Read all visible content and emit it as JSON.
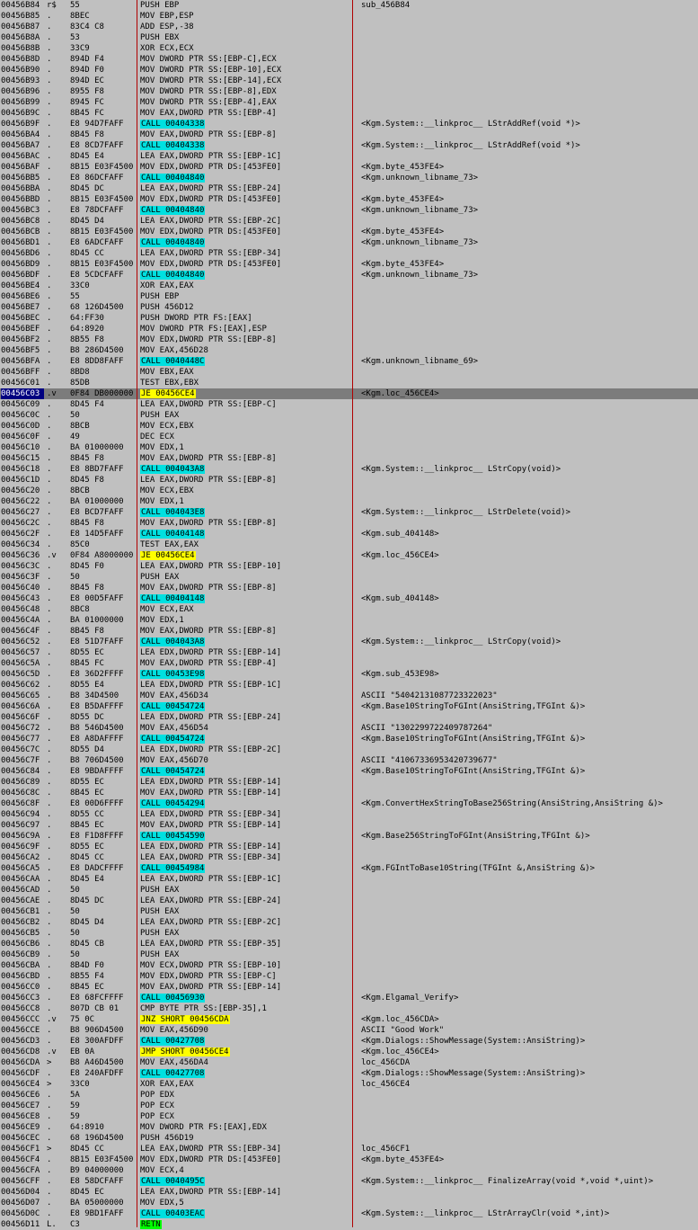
{
  "colors": {
    "background": "#c0c0c0",
    "call_highlight": "#00e0e0",
    "jump_highlight": "#ffff00",
    "ret_highlight": "#00ff00",
    "selected_row": "#7c7c7c",
    "address_selected": "#000080",
    "column_divider": "#b00000"
  },
  "rows": [
    {
      "addr": "00456B84",
      "mark": "r$",
      "hex": "55",
      "ins": "PUSH EBP",
      "cmt": "sub_456B84"
    },
    {
      "addr": "00456B85",
      "mark": ".",
      "hex": "8BEC",
      "ins": "MOV EBP,ESP",
      "cmt": ""
    },
    {
      "addr": "00456B87",
      "mark": ".",
      "hex": "83C4 C8",
      "ins": "ADD ESP,-38",
      "cmt": ""
    },
    {
      "addr": "00456B8A",
      "mark": ".",
      "hex": "53",
      "ins": "PUSH EBX",
      "cmt": ""
    },
    {
      "addr": "00456B8B",
      "mark": ".",
      "hex": "33C9",
      "ins": "XOR ECX,ECX",
      "cmt": ""
    },
    {
      "addr": "00456B8D",
      "mark": ".",
      "hex": "894D F4",
      "ins": "MOV DWORD PTR SS:[EBP-C],ECX",
      "cmt": ""
    },
    {
      "addr": "00456B90",
      "mark": ".",
      "hex": "894D F0",
      "ins": "MOV DWORD PTR SS:[EBP-10],ECX",
      "cmt": ""
    },
    {
      "addr": "00456B93",
      "mark": ".",
      "hex": "894D EC",
      "ins": "MOV DWORD PTR SS:[EBP-14],ECX",
      "cmt": ""
    },
    {
      "addr": "00456B96",
      "mark": ".",
      "hex": "8955 F8",
      "ins": "MOV DWORD PTR SS:[EBP-8],EDX",
      "cmt": ""
    },
    {
      "addr": "00456B99",
      "mark": ".",
      "hex": "8945 FC",
      "ins": "MOV DWORD PTR SS:[EBP-4],EAX",
      "cmt": ""
    },
    {
      "addr": "00456B9C",
      "mark": ".",
      "hex": "8B45 FC",
      "ins": "MOV EAX,DWORD PTR SS:[EBP-4]",
      "cmt": ""
    },
    {
      "addr": "00456B9F",
      "mark": ".",
      "hex": "E8 94D7FAFF",
      "ins": "CALL 00404338",
      "cmt": "<Kgm.System::__linkproc__ LStrAddRef(void *)>"
    },
    {
      "addr": "00456BA4",
      "mark": ".",
      "hex": "8B45 F8",
      "ins": "MOV EAX,DWORD PTR SS:[EBP-8]",
      "cmt": ""
    },
    {
      "addr": "00456BA7",
      "mark": ".",
      "hex": "E8 8CD7FAFF",
      "ins": "CALL 00404338",
      "cmt": "<Kgm.System::__linkproc__ LStrAddRef(void *)>"
    },
    {
      "addr": "00456BAC",
      "mark": ".",
      "hex": "8D45 E4",
      "ins": "LEA EAX,DWORD PTR SS:[EBP-1C]",
      "cmt": ""
    },
    {
      "addr": "00456BAF",
      "mark": ".",
      "hex": "8B15 E03F4500",
      "ins": "MOV EDX,DWORD PTR DS:[453FE0]",
      "cmt": "<Kgm.byte_453FE4>"
    },
    {
      "addr": "00456BB5",
      "mark": ".",
      "hex": "E8 86DCFAFF",
      "ins": "CALL 00404840",
      "cmt": "<Kgm.unknown_libname_73>"
    },
    {
      "addr": "00456BBA",
      "mark": ".",
      "hex": "8D45 DC",
      "ins": "LEA EAX,DWORD PTR SS:[EBP-24]",
      "cmt": ""
    },
    {
      "addr": "00456BBD",
      "mark": ".",
      "hex": "8B15 E03F4500",
      "ins": "MOV EDX,DWORD PTR DS:[453FE0]",
      "cmt": "<Kgm.byte_453FE4>"
    },
    {
      "addr": "00456BC3",
      "mark": ".",
      "hex": "E8 78DCFAFF",
      "ins": "CALL 00404840",
      "cmt": "<Kgm.unknown_libname_73>"
    },
    {
      "addr": "00456BC8",
      "mark": ".",
      "hex": "8D45 D4",
      "ins": "LEA EAX,DWORD PTR SS:[EBP-2C]",
      "cmt": ""
    },
    {
      "addr": "00456BCB",
      "mark": ".",
      "hex": "8B15 E03F4500",
      "ins": "MOV EDX,DWORD PTR DS:[453FE0]",
      "cmt": "<Kgm.byte_453FE4>"
    },
    {
      "addr": "00456BD1",
      "mark": ".",
      "hex": "E8 6ADCFAFF",
      "ins": "CALL 00404840",
      "cmt": "<Kgm.unknown_libname_73>"
    },
    {
      "addr": "00456BD6",
      "mark": ".",
      "hex": "8D45 CC",
      "ins": "LEA EAX,DWORD PTR SS:[EBP-34]",
      "cmt": ""
    },
    {
      "addr": "00456BD9",
      "mark": ".",
      "hex": "8B15 E03F4500",
      "ins": "MOV EDX,DWORD PTR DS:[453FE0]",
      "cmt": "<Kgm.byte_453FE4>"
    },
    {
      "addr": "00456BDF",
      "mark": ".",
      "hex": "E8 5CDCFAFF",
      "ins": "CALL 00404840",
      "cmt": "<Kgm.unknown_libname_73>"
    },
    {
      "addr": "00456BE4",
      "mark": ".",
      "hex": "33C0",
      "ins": "XOR EAX,EAX",
      "cmt": ""
    },
    {
      "addr": "00456BE6",
      "mark": ".",
      "hex": "55",
      "ins": "PUSH EBP",
      "cmt": ""
    },
    {
      "addr": "00456BE7",
      "mark": ".",
      "hex": "68 126D4500",
      "ins": "PUSH 456D12",
      "cmt": ""
    },
    {
      "addr": "00456BEC",
      "mark": ".",
      "hex": "64:FF30",
      "ins": "PUSH DWORD PTR FS:[EAX]",
      "cmt": ""
    },
    {
      "addr": "00456BEF",
      "mark": ".",
      "hex": "64:8920",
      "ins": "MOV DWORD PTR FS:[EAX],ESP",
      "cmt": ""
    },
    {
      "addr": "00456BF2",
      "mark": ".",
      "hex": "8B55 F8",
      "ins": "MOV EDX,DWORD PTR SS:[EBP-8]",
      "cmt": ""
    },
    {
      "addr": "00456BF5",
      "mark": ".",
      "hex": "B8 286D4500",
      "ins": "MOV EAX,456D28",
      "cmt": ""
    },
    {
      "addr": "00456BFA",
      "mark": ".",
      "hex": "E8 8DD8FAFF",
      "ins": "CALL 0040448C",
      "cmt": "<Kgm.unknown_libname_69>"
    },
    {
      "addr": "00456BFF",
      "mark": ".",
      "hex": "8BD8",
      "ins": "MOV EBX,EAX",
      "cmt": ""
    },
    {
      "addr": "00456C01",
      "mark": ".",
      "hex": "85DB",
      "ins": "TEST EBX,EBX",
      "cmt": ""
    },
    {
      "addr": "00456C03",
      "mark": ".v",
      "hex": "0F84 DB000000",
      "ins": "JE 00456CE4",
      "cmt": "<Kgm.loc_456CE4>",
      "selected": true
    },
    {
      "addr": "00456C09",
      "mark": ".",
      "hex": "8D45 F4",
      "ins": "LEA EAX,DWORD PTR SS:[EBP-C]",
      "cmt": ""
    },
    {
      "addr": "00456C0C",
      "mark": ".",
      "hex": "50",
      "ins": "PUSH EAX",
      "cmt": ""
    },
    {
      "addr": "00456C0D",
      "mark": ".",
      "hex": "8BCB",
      "ins": "MOV ECX,EBX",
      "cmt": ""
    },
    {
      "addr": "00456C0F",
      "mark": ".",
      "hex": "49",
      "ins": "DEC ECX",
      "cmt": ""
    },
    {
      "addr": "00456C10",
      "mark": ".",
      "hex": "BA 01000000",
      "ins": "MOV EDX,1",
      "cmt": ""
    },
    {
      "addr": "00456C15",
      "mark": ".",
      "hex": "8B45 F8",
      "ins": "MOV EAX,DWORD PTR SS:[EBP-8]",
      "cmt": ""
    },
    {
      "addr": "00456C18",
      "mark": ".",
      "hex": "E8 8BD7FAFF",
      "ins": "CALL 004043A8",
      "cmt": "<Kgm.System::__linkproc__ LStrCopy(void)>"
    },
    {
      "addr": "00456C1D",
      "mark": ".",
      "hex": "8D45 F8",
      "ins": "LEA EAX,DWORD PTR SS:[EBP-8]",
      "cmt": ""
    },
    {
      "addr": "00456C20",
      "mark": ".",
      "hex": "8BCB",
      "ins": "MOV ECX,EBX",
      "cmt": ""
    },
    {
      "addr": "00456C22",
      "mark": ".",
      "hex": "BA 01000000",
      "ins": "MOV EDX,1",
      "cmt": ""
    },
    {
      "addr": "00456C27",
      "mark": ".",
      "hex": "E8 BCD7FAFF",
      "ins": "CALL 004043E8",
      "cmt": "<Kgm.System::__linkproc__ LStrDelete(void)>"
    },
    {
      "addr": "00456C2C",
      "mark": ".",
      "hex": "8B45 F8",
      "ins": "MOV EAX,DWORD PTR SS:[EBP-8]",
      "cmt": ""
    },
    {
      "addr": "00456C2F",
      "mark": ".",
      "hex": "E8 14D5FAFF",
      "ins": "CALL 00404148",
      "cmt": "<Kgm.sub_404148>"
    },
    {
      "addr": "00456C34",
      "mark": ".",
      "hex": "85C0",
      "ins": "TEST EAX,EAX",
      "cmt": ""
    },
    {
      "addr": "00456C36",
      "mark": ".v",
      "hex": "0F84 A8000000",
      "ins": "JE 00456CE4",
      "cmt": "<Kgm.loc_456CE4>"
    },
    {
      "addr": "00456C3C",
      "mark": ".",
      "hex": "8D45 F0",
      "ins": "LEA EAX,DWORD PTR SS:[EBP-10]",
      "cmt": ""
    },
    {
      "addr": "00456C3F",
      "mark": ".",
      "hex": "50",
      "ins": "PUSH EAX",
      "cmt": ""
    },
    {
      "addr": "00456C40",
      "mark": ".",
      "hex": "8B45 F8",
      "ins": "MOV EAX,DWORD PTR SS:[EBP-8]",
      "cmt": ""
    },
    {
      "addr": "00456C43",
      "mark": ".",
      "hex": "E8 00D5FAFF",
      "ins": "CALL 00404148",
      "cmt": "<Kgm.sub_404148>"
    },
    {
      "addr": "00456C48",
      "mark": ".",
      "hex": "8BC8",
      "ins": "MOV ECX,EAX",
      "cmt": ""
    },
    {
      "addr": "00456C4A",
      "mark": ".",
      "hex": "BA 01000000",
      "ins": "MOV EDX,1",
      "cmt": ""
    },
    {
      "addr": "00456C4F",
      "mark": ".",
      "hex": "8B45 F8",
      "ins": "MOV EAX,DWORD PTR SS:[EBP-8]",
      "cmt": ""
    },
    {
      "addr": "00456C52",
      "mark": ".",
      "hex": "E8 51D7FAFF",
      "ins": "CALL 004043A8",
      "cmt": "<Kgm.System::__linkproc__ LStrCopy(void)>"
    },
    {
      "addr": "00456C57",
      "mark": ".",
      "hex": "8D55 EC",
      "ins": "LEA EDX,DWORD PTR SS:[EBP-14]",
      "cmt": ""
    },
    {
      "addr": "00456C5A",
      "mark": ".",
      "hex": "8B45 FC",
      "ins": "MOV EAX,DWORD PTR SS:[EBP-4]",
      "cmt": ""
    },
    {
      "addr": "00456C5D",
      "mark": ".",
      "hex": "E8 36D2FFFF",
      "ins": "CALL 00453E98",
      "cmt": "<Kgm.sub_453E98>"
    },
    {
      "addr": "00456C62",
      "mark": ".",
      "hex": "8D55 E4",
      "ins": "LEA EDX,DWORD PTR SS:[EBP-1C]",
      "cmt": ""
    },
    {
      "addr": "00456C65",
      "mark": ".",
      "hex": "B8 34D4500",
      "ins": "MOV EAX,456D34",
      "cmt": "ASCII \"54042131087723322023\""
    },
    {
      "addr": "00456C6A",
      "mark": ".",
      "hex": "E8 B5DAFFFF",
      "ins": "CALL 00454724",
      "cmt": "<Kgm.Base10StringToFGInt(AnsiString,TFGInt &)>"
    },
    {
      "addr": "00456C6F",
      "mark": ".",
      "hex": "8D55 DC",
      "ins": "LEA EDX,DWORD PTR SS:[EBP-24]",
      "cmt": ""
    },
    {
      "addr": "00456C72",
      "mark": ".",
      "hex": "B8 546D4500",
      "ins": "MOV EAX,456D54",
      "cmt": "ASCII \"1302299722409787264\""
    },
    {
      "addr": "00456C77",
      "mark": ".",
      "hex": "E8 A8DAFFFF",
      "ins": "CALL 00454724",
      "cmt": "<Kgm.Base10StringToFGInt(AnsiString,TFGInt &)>"
    },
    {
      "addr": "00456C7C",
      "mark": ".",
      "hex": "8D55 D4",
      "ins": "LEA EDX,DWORD PTR SS:[EBP-2C]",
      "cmt": ""
    },
    {
      "addr": "00456C7F",
      "mark": ".",
      "hex": "B8 706D4500",
      "ins": "MOV EAX,456D70",
      "cmt": "ASCII \"41067336953420739677\""
    },
    {
      "addr": "00456C84",
      "mark": ".",
      "hex": "E8 9BDAFFFF",
      "ins": "CALL 00454724",
      "cmt": "<Kgm.Base10StringToFGInt(AnsiString,TFGInt &)>"
    },
    {
      "addr": "00456C89",
      "mark": ".",
      "hex": "8D55 EC",
      "ins": "LEA EDX,DWORD PTR SS:[EBP-14]",
      "cmt": ""
    },
    {
      "addr": "00456C8C",
      "mark": ".",
      "hex": "8B45 EC",
      "ins": "MOV EAX,DWORD PTR SS:[EBP-14]",
      "cmt": ""
    },
    {
      "addr": "00456C8F",
      "mark": ".",
      "hex": "E8 00D6FFFF",
      "ins": "CALL 00454294",
      "cmt": "<Kgm.ConvertHexStringToBase256String(AnsiString,AnsiString &)>"
    },
    {
      "addr": "00456C94",
      "mark": ".",
      "hex": "8D55 CC",
      "ins": "LEA EDX,DWORD PTR SS:[EBP-34]",
      "cmt": ""
    },
    {
      "addr": "00456C97",
      "mark": ".",
      "hex": "8B45 EC",
      "ins": "MOV EAX,DWORD PTR SS:[EBP-14]",
      "cmt": ""
    },
    {
      "addr": "00456C9A",
      "mark": ".",
      "hex": "E8 F1D8FFFF",
      "ins": "CALL 00454590",
      "cmt": "<Kgm.Base256StringToFGInt(AnsiString,TFGInt &)>"
    },
    {
      "addr": "00456C9F",
      "mark": ".",
      "hex": "8D55 EC",
      "ins": "LEA EDX,DWORD PTR SS:[EBP-14]",
      "cmt": ""
    },
    {
      "addr": "00456CA2",
      "mark": ".",
      "hex": "8D45 CC",
      "ins": "LEA EAX,DWORD PTR SS:[EBP-34]",
      "cmt": ""
    },
    {
      "addr": "00456CA5",
      "mark": ".",
      "hex": "E8 DADCFFFF",
      "ins": "CALL 00454984",
      "cmt": "<Kgm.FGIntToBase10String(TFGInt &,AnsiString &)>"
    },
    {
      "addr": "00456CAA",
      "mark": ".",
      "hex": "8D45 E4",
      "ins": "LEA EAX,DWORD PTR SS:[EBP-1C]",
      "cmt": ""
    },
    {
      "addr": "00456CAD",
      "mark": ".",
      "hex": "50",
      "ins": "PUSH EAX",
      "cmt": ""
    },
    {
      "addr": "00456CAE",
      "mark": ".",
      "hex": "8D45 DC",
      "ins": "LEA EAX,DWORD PTR SS:[EBP-24]",
      "cmt": ""
    },
    {
      "addr": "00456CB1",
      "mark": ".",
      "hex": "50",
      "ins": "PUSH EAX",
      "cmt": ""
    },
    {
      "addr": "00456CB2",
      "mark": ".",
      "hex": "8D45 D4",
      "ins": "LEA EAX,DWORD PTR SS:[EBP-2C]",
      "cmt": ""
    },
    {
      "addr": "00456CB5",
      "mark": ".",
      "hex": "50",
      "ins": "PUSH EAX",
      "cmt": ""
    },
    {
      "addr": "00456CB6",
      "mark": ".",
      "hex": "8D45 CB",
      "ins": "LEA EAX,DWORD PTR SS:[EBP-35]",
      "cmt": ""
    },
    {
      "addr": "00456CB9",
      "mark": ".",
      "hex": "50",
      "ins": "PUSH EAX",
      "cmt": ""
    },
    {
      "addr": "00456CBA",
      "mark": ".",
      "hex": "8B4D F0",
      "ins": "MOV ECX,DWORD PTR SS:[EBP-10]",
      "cmt": ""
    },
    {
      "addr": "00456CBD",
      "mark": ".",
      "hex": "8B55 F4",
      "ins": "MOV EDX,DWORD PTR SS:[EBP-C]",
      "cmt": ""
    },
    {
      "addr": "00456CC0",
      "mark": ".",
      "hex": "8B45 EC",
      "ins": "MOV EAX,DWORD PTR SS:[EBP-14]",
      "cmt": ""
    },
    {
      "addr": "00456CC3",
      "mark": ".",
      "hex": "E8 68FCFFFF",
      "ins": "CALL 00456930",
      "cmt": "<Kgm.Elgamal_Verify>"
    },
    {
      "addr": "00456CC8",
      "mark": ".",
      "hex": "807D CB 01",
      "ins": "CMP BYTE PTR SS:[EBP-35],1",
      "cmt": ""
    },
    {
      "addr": "00456CCC",
      "mark": ".v",
      "hex": "75 0C",
      "ins": "JNZ SHORT 00456CDA",
      "cmt": "<Kgm.loc_456CDA>"
    },
    {
      "addr": "00456CCE",
      "mark": ".",
      "hex": "B8 906D4500",
      "ins": "MOV EAX,456D90",
      "cmt": "ASCII \"Good Work\""
    },
    {
      "addr": "00456CD3",
      "mark": ".",
      "hex": "E8 300AFDFF",
      "ins": "CALL 00427708",
      "cmt": "<Kgm.Dialogs::ShowMessage(System::AnsiString)>"
    },
    {
      "addr": "00456CD8",
      "mark": ".v",
      "hex": "EB 0A",
      "ins": "JMP SHORT 00456CE4",
      "cmt": "<Kgm.loc_456CE4>"
    },
    {
      "addr": "00456CDA",
      "mark": ">",
      "hex": "B8 A46D4500",
      "ins": "MOV EAX,456DA4",
      "cmt": "loc_456CDA"
    },
    {
      "addr": "00456CDF",
      "mark": ".",
      "hex": "E8 240AFDFF",
      "ins": "CALL 00427708",
      "cmt": "<Kgm.Dialogs::ShowMessage(System::AnsiString)>"
    },
    {
      "addr": "00456CE4",
      "mark": ">",
      "hex": "33C0",
      "ins": "XOR EAX,EAX",
      "cmt": "loc_456CE4"
    },
    {
      "addr": "00456CE6",
      "mark": ".",
      "hex": "5A",
      "ins": "POP EDX",
      "cmt": ""
    },
    {
      "addr": "00456CE7",
      "mark": ".",
      "hex": "59",
      "ins": "POP ECX",
      "cmt": ""
    },
    {
      "addr": "00456CE8",
      "mark": ".",
      "hex": "59",
      "ins": "POP ECX",
      "cmt": ""
    },
    {
      "addr": "00456CE9",
      "mark": ".",
      "hex": "64:8910",
      "ins": "MOV DWORD PTR FS:[EAX],EDX",
      "cmt": ""
    },
    {
      "addr": "00456CEC",
      "mark": ".",
      "hex": "68 196D4500",
      "ins": "PUSH 456D19",
      "cmt": ""
    },
    {
      "addr": "00456CF1",
      "mark": ">",
      "hex": "8D45 CC",
      "ins": "LEA EAX,DWORD PTR SS:[EBP-34]",
      "cmt": "loc_456CF1"
    },
    {
      "addr": "00456CF4",
      "mark": ".",
      "hex": "8B15 E03F4500",
      "ins": "MOV EDX,DWORD PTR DS:[453FE0]",
      "cmt": "<Kgm.byte_453FE4>"
    },
    {
      "addr": "00456CFA",
      "mark": ".",
      "hex": "B9 04000000",
      "ins": "MOV ECX,4",
      "cmt": ""
    },
    {
      "addr": "00456CFF",
      "mark": ".",
      "hex": "E8 58DCFAFF",
      "ins": "CALL 0040495C",
      "cmt": "<Kgm.System::__linkproc__ FinalizeArray(void *,void *,uint)>"
    },
    {
      "addr": "00456D04",
      "mark": ".",
      "hex": "8D45 EC",
      "ins": "LEA EAX,DWORD PTR SS:[EBP-14]",
      "cmt": ""
    },
    {
      "addr": "00456D07",
      "mark": ".",
      "hex": "BA 05000000",
      "ins": "MOV EDX,5",
      "cmt": ""
    },
    {
      "addr": "00456D0C",
      "mark": ".",
      "hex": "E8 9BD1FAFF",
      "ins": "CALL 00403EAC",
      "cmt": "<Kgm.System::__linkproc__ LStrArrayClr(void *,int)>"
    },
    {
      "addr": "00456D11",
      "mark": "L.",
      "hex": "C3",
      "ins": "RETN",
      "cmt": ""
    }
  ]
}
